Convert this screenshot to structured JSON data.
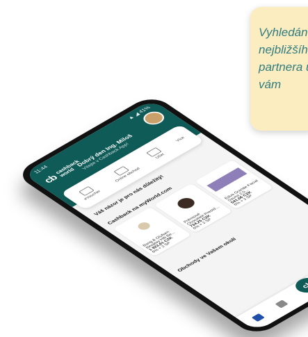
{
  "callout": {
    "lines": [
      "Vyhledání",
      "nejbližšího",
      "partnera u",
      "vám"
    ]
  },
  "app": {
    "status_time": "11:44",
    "status_right": "▲ ◢ 41%",
    "logo_mark": "cb",
    "logo_word_1": "cashback",
    "logo_word_2": "world",
    "greeting": "Dobrý den Ing. Miloš",
    "subtitle": "Vítejte v Cashback App!",
    "tabs": [
      {
        "label": "eVoucher"
      },
      {
        "label": "Online obchod"
      },
      {
        "label": "Účet"
      }
    ],
    "tabs_more": "Více",
    "opinion": "Váš názor je pro nás důležitý!",
    "section_cashback": "Cashback na myWorld.com",
    "products": [
      {
        "name": "Bang & Olufsen Beoplay H8i Be...",
        "price": "1 923,61 CZK",
        "cashback": "6% + 2 SP"
      },
      {
        "name": "Prémiové Chocolate Prestiž...",
        "price": "734,25 CZK",
        "cashback": "6% + 2 SP"
      },
      {
        "name": "Eduo Grande Facial Sauna 2.0...",
        "price": "541,56 CZK",
        "cashback": "6% + 2 SP"
      }
    ],
    "section_shops": "Obchody ve Vašem okolí",
    "fab_label": "cb"
  }
}
